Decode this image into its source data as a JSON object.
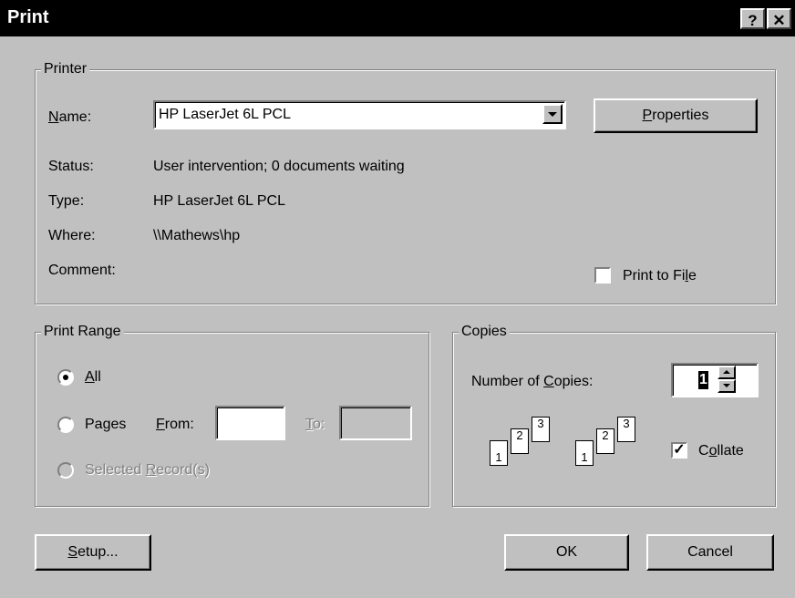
{
  "window": {
    "title": "Print",
    "help_label": "?",
    "close_label": "✕"
  },
  "printer": {
    "group_title": "Printer",
    "name_label_accel": "N",
    "name_label_rest": "ame:",
    "name_value": "HP LaserJet 6L PCL",
    "properties_accel": "P",
    "properties_rest": "roperties",
    "status_label": "Status:",
    "status_value": "User intervention; 0 documents waiting",
    "type_label": "Type:",
    "type_value": "HP LaserJet 6L PCL",
    "where_label": "Where:",
    "where_value": "\\\\Mathews\\hp",
    "comment_label": "Comment:",
    "print_to_file_pre": "Print to Fi",
    "print_to_file_accel": "l",
    "print_to_file_post": "e",
    "print_to_file_checked": false
  },
  "print_range": {
    "group_title": "Print Range",
    "all_accel": "A",
    "all_rest": "ll",
    "all_selected": true,
    "pages_pre": "Pa",
    "pages_accel": "g",
    "pages_post": "es",
    "from_accel": "F",
    "from_rest": "rom:",
    "from_value": "",
    "to_accel": "T",
    "to_rest": "o:",
    "to_value": "",
    "selected_pre": "Selected ",
    "selected_accel": "R",
    "selected_post": "ecord(s)"
  },
  "copies": {
    "group_title": "Copies",
    "number_pre": "Number of ",
    "number_accel": "C",
    "number_post": "opies:",
    "number_value": "1",
    "collate_pre": "C",
    "collate_accel": "o",
    "collate_post": "llate",
    "collate_checked": true,
    "page_labels": [
      "1",
      "2",
      "3"
    ]
  },
  "buttons": {
    "setup_accel": "S",
    "setup_rest": "etup...",
    "ok": "OK",
    "cancel": "Cancel"
  },
  "colors": {
    "face": "#c0c0c0",
    "titlebar": "#000000",
    "disabled_text": "#808080"
  }
}
